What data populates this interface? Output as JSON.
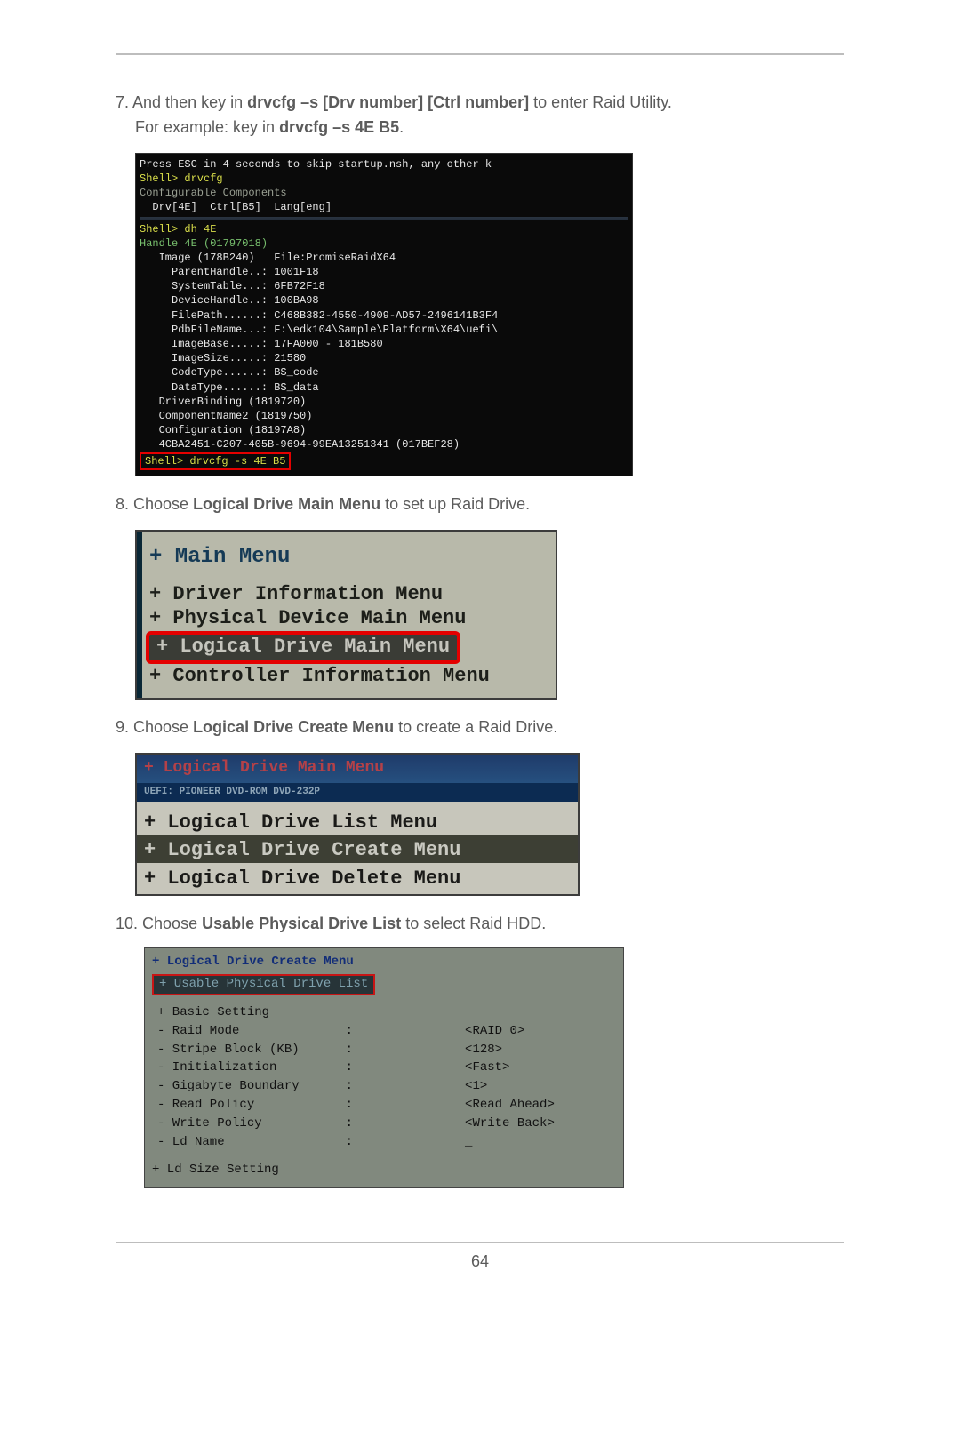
{
  "page_number": "64",
  "step7": {
    "num": "7. ",
    "pre1": "And then key in ",
    "b1": "drvcfg –s [Drv number] [Ctrl number]",
    "post1": " to enter Raid Utility.",
    "line2a": "For example: key in ",
    "b2": "drvcfg –s 4E B5",
    "line2b": "."
  },
  "shell": {
    "top": "Press ESC in 4 seconds to skip startup.nsh, any other k",
    "l1": "Shell> drvcfg",
    "l2": "Configurable Components",
    "l3": "  Drv[4E]  Ctrl[B5]  Lang[eng]",
    "l4": "Shell> dh 4E",
    "l5": "Handle 4E (01797018)",
    "l6": "   Image (178B240)   File:PromiseRaidX64",
    "l7": "     ParentHandle..: 1001F18",
    "l8": "     SystemTable...: 6FB72F18",
    "l9": "     DeviceHandle..: 100BA98",
    "l10": "     FilePath......: C468B382-4550-4909-AD57-2496141B3F4",
    "l11": "     PdbFileName...: F:\\edk104\\Sample\\Platform\\X64\\uefi\\",
    "l12": "     ImageBase.....: 17FA000 - 181B580",
    "l13": "     ImageSize.....: 21580",
    "l14": "     CodeType......: BS_code",
    "l15": "     DataType......: BS_data",
    "l16": "   DriverBinding (1819720)",
    "l17": "   ComponentName2 (1819750)",
    "l18": "   Configuration (18197A8)",
    "l19": "   4CBA2451-C207-405B-9694-99EA13251341 (017BEF28)",
    "cmd": "Shell> drvcfg -s 4E B5"
  },
  "step8": {
    "num": "8. ",
    "pre": "Choose ",
    "b": "Logical Drive Main Menu",
    "post": " to set up Raid Drive."
  },
  "menu8": {
    "title": "+ Main Menu",
    "i1": "+ Driver Information Menu",
    "i2": "+ Physical Device Main Menu",
    "i3": "+ Logical Drive Main Menu",
    "i4": "+ Controller Information Menu"
  },
  "step9": {
    "num": "9. ",
    "pre": "Choose ",
    "b": "Logical Drive Create Menu",
    "post": " to create a Raid Drive."
  },
  "menu9": {
    "hd": "+ Logical Drive Main Menu",
    "sub": "  UEFI: PIONEER DVD-ROM DVD-232P",
    "i1": "+ Logical Drive List Menu",
    "i2": "+ Logical Drive Create Menu",
    "i3": "+ Logical Drive Delete Menu"
  },
  "step10": {
    "num": "10. ",
    "pre": "Choose ",
    "b": "Usable Physical Drive List",
    "post": " to select Raid HDD."
  },
  "menu10": {
    "hd": "+ Logical Drive Create Menu",
    "sel": "+ Usable Physical Drive List",
    "rows": [
      {
        "k": "+ Basic Setting",
        "c": "",
        "v": ""
      },
      {
        "k": "- Raid Mode",
        "c": ":",
        "v": "<RAID 0>"
      },
      {
        "k": "- Stripe Block (KB)",
        "c": ":",
        "v": "<128>"
      },
      {
        "k": "- Initialization",
        "c": ":",
        "v": "<Fast>"
      },
      {
        "k": "- Gigabyte Boundary",
        "c": ":",
        "v": "<1>"
      },
      {
        "k": "- Read Policy",
        "c": ":",
        "v": "<Read Ahead>"
      },
      {
        "k": "- Write Policy",
        "c": ":",
        "v": "<Write Back>"
      },
      {
        "k": "- Ld Name",
        "c": ":",
        "v": "_"
      }
    ],
    "plus": "+ Ld Size Setting"
  }
}
